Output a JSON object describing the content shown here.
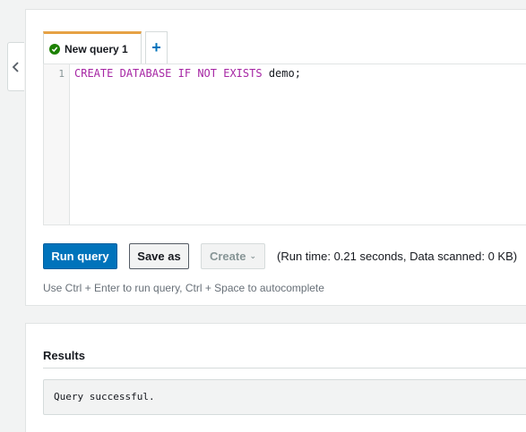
{
  "sidebar": {
    "collapse_icon": "chevron-left-icon"
  },
  "tabs": [
    {
      "label": "New query 1",
      "status": "success",
      "status_icon": "check-circle-icon",
      "accent_color": "#e6a245"
    },
    {
      "label": "+",
      "icon": "add-icon"
    }
  ],
  "editor": {
    "lines": [
      {
        "number": "1",
        "tokens": [
          {
            "text": "CREATE",
            "kind": "keyword"
          },
          {
            "text": " ",
            "kind": "space"
          },
          {
            "text": "DATABASE",
            "kind": "keyword"
          },
          {
            "text": " ",
            "kind": "space"
          },
          {
            "text": "IF",
            "kind": "keyword"
          },
          {
            "text": " ",
            "kind": "space"
          },
          {
            "text": "NOT",
            "kind": "keyword"
          },
          {
            "text": " ",
            "kind": "space"
          },
          {
            "text": "EXISTS",
            "kind": "keyword"
          },
          {
            "text": " demo;",
            "kind": "identifier"
          }
        ]
      }
    ],
    "keyword_color": "#a626a4"
  },
  "toolbar": {
    "run_label": "Run query",
    "save_as_label": "Save as",
    "create_label": "Create",
    "create_disabled": true,
    "run_info": "(Run time: 0.21 seconds, Data scanned: 0 KB)"
  },
  "hint": "Use Ctrl + Enter to run query, Ctrl + Space to autocomplete",
  "results": {
    "title": "Results",
    "message": "Query successful."
  },
  "colors": {
    "primary": "#0073bb",
    "success": "#1d8102",
    "background": "#f2f3f3"
  }
}
